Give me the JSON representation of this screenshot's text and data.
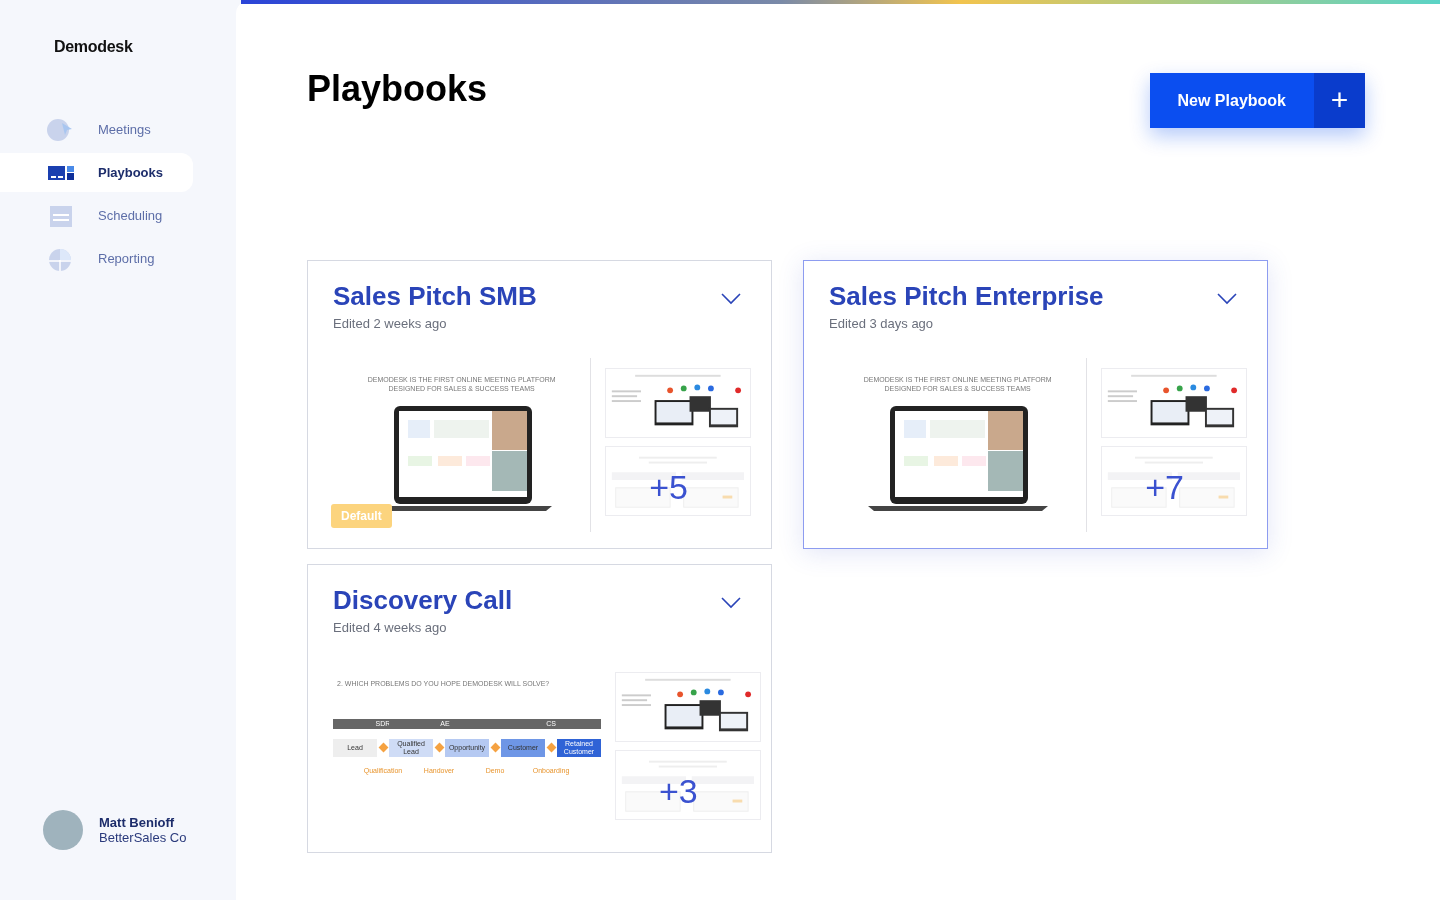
{
  "sidebar": {
    "logo": "Demodesk",
    "items": [
      {
        "label": "Meetings",
        "selected": false
      },
      {
        "label": "Playbooks",
        "selected": true
      },
      {
        "label": "Scheduling",
        "selected": false
      },
      {
        "label": "Reporting",
        "selected": false
      }
    ],
    "user": {
      "name": "Matt Benioff",
      "company": "BetterSales Co"
    }
  },
  "page": {
    "title": "Playbooks",
    "new_button": "New Playbook",
    "new_button_icon": "+"
  },
  "playbooks": [
    {
      "title": "Sales Pitch SMB",
      "edited": "Edited 2 weeks ago",
      "selected": false,
      "badge": "Default",
      "more": "+5",
      "slide": {
        "kind": "laptop",
        "title": "DEMODESK IS THE FIRST ONLINE MEETING PLATFORM DESIGNED FOR SALES & SUCCESS TEAMS"
      }
    },
    {
      "title": "Sales Pitch Enterprise",
      "edited": "Edited 3 days ago",
      "selected": true,
      "more": "+7",
      "slide": {
        "kind": "laptop",
        "title": "DEMODESK IS THE FIRST ONLINE MEETING PLATFORM DESIGNED FOR SALES & SUCCESS TEAMS"
      }
    },
    {
      "title": "Discovery Call",
      "edited": "Edited 4 weeks ago",
      "selected": false,
      "more": "+3",
      "slide": {
        "kind": "flow",
        "title": "2. WHICH PROBLEMS DO YOU HOPE DEMODESK WILL SOLVE?",
        "teams": [
          "SDR",
          "AE",
          "CS"
        ],
        "stages": [
          "Lead",
          "Qualified Lead",
          "Opportunity",
          "Customer",
          "Retained Customer"
        ],
        "steps": [
          "Qualification",
          "Handover",
          "Demo",
          "Onboarding"
        ]
      }
    }
  ]
}
